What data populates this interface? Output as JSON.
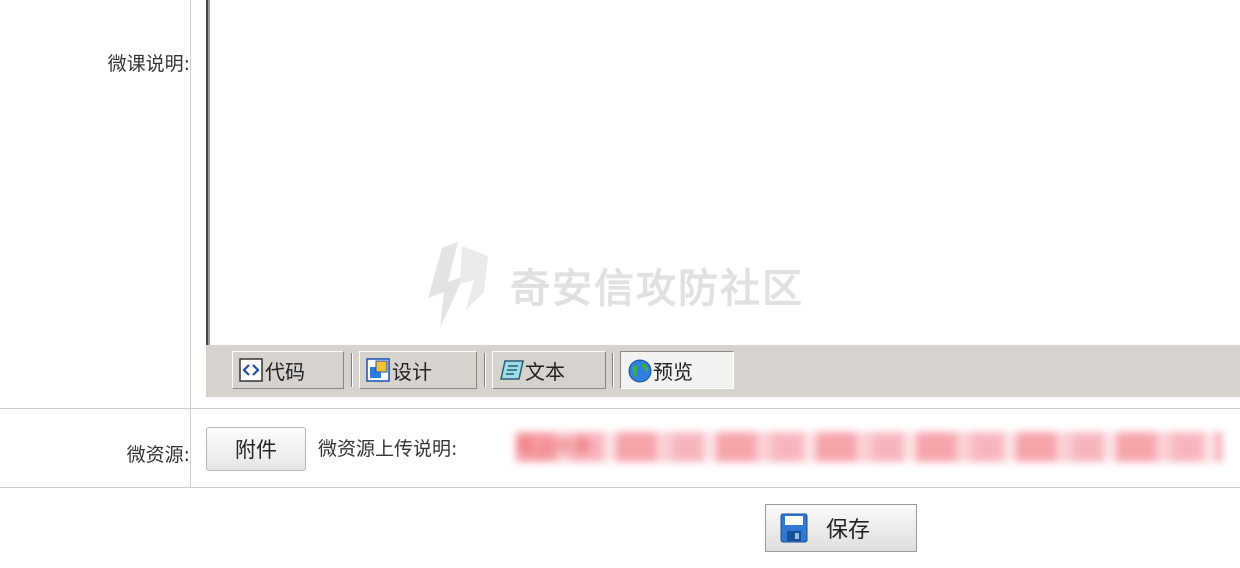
{
  "form": {
    "description_label": "微课说明:",
    "resource_label": "微资源:"
  },
  "editor": {
    "modes": [
      {
        "label": "代码",
        "icon": "code-icon",
        "active": false
      },
      {
        "label": "设计",
        "icon": "design-icon",
        "active": false
      },
      {
        "label": "文本",
        "icon": "text-icon",
        "active": false
      },
      {
        "label": "预览",
        "icon": "globe-icon",
        "active": true
      }
    ]
  },
  "watermark": {
    "text": "奇安信攻防社区",
    "icon": "bolt-shield-icon"
  },
  "resource": {
    "attach_label": "附件",
    "upload_note_label": "微资源上传说明:",
    "upload_note_text": "可上传多"
  },
  "actions": {
    "save_label": "保存",
    "save_icon": "floppy-disk-icon"
  },
  "colors": {
    "note_red": "#e02020",
    "toolbar_gray": "#d6d3ce",
    "divider": "#cfcfcf"
  }
}
